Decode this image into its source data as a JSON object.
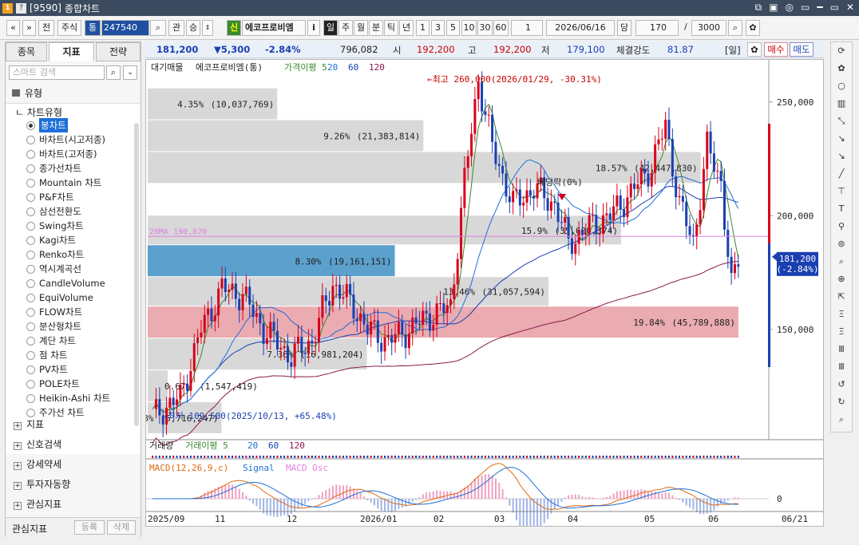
{
  "window": {
    "code": "[9590]",
    "title": "종합차트",
    "controls": [
      "⧉",
      "▣",
      "◎",
      "▭",
      "━",
      "▭",
      "✕"
    ]
  },
  "toolbar": {
    "nav_left": "«",
    "nav_down": "»",
    "jeon": "전",
    "jusik": "주식",
    "tong": "통",
    "code": "247540",
    "kwan": "관",
    "seung": "승",
    "sin_badge": "신",
    "stock_name": "에코프로비엠",
    "info": "i",
    "periods": [
      "일",
      "주",
      "월",
      "분",
      "틱",
      "년"
    ],
    "minute_opts": [
      "1",
      "3",
      "5",
      "10",
      "30",
      "60"
    ],
    "count_sel": "1",
    "date": "2026/06/16",
    "dang": "당",
    "bars": "170",
    "slash": "/",
    "total": "3000"
  },
  "left_panel": {
    "tabs": [
      "종목",
      "지표",
      "전략"
    ],
    "search_placeholder": "스마트 검색",
    "root": "유형",
    "sub_root": "차트유형",
    "chart_types": [
      "봉차트",
      "바차트(시고저종)",
      "바차트(고저종)",
      "종가선차트",
      "Mountain 차트",
      "P&F차트",
      "삼선전환도",
      "Swing차트",
      "Kagi차트",
      "Renko차트",
      "역시계곡선",
      "CandleVolume",
      "EquiVolume",
      "FLOW차트",
      "분산형차트",
      "계단 차트",
      "점 차트",
      "PV차트",
      "POLE차트",
      "Heikin-Ashi 차트",
      "주가선 차트"
    ],
    "groups": [
      "지표",
      "신호검색",
      "강세약세",
      "투자자동향",
      "관심지표"
    ],
    "footer_label": "관심지표",
    "register": "등록",
    "delete": "삭제"
  },
  "quote": {
    "price": "181,200",
    "change": "▼5,300",
    "pct": "-2.84%",
    "volume": "796,082",
    "open_label": "시",
    "open": "192,200",
    "high_label": "고",
    "high": "192,200",
    "low_label": "저",
    "low": "179,100",
    "strength_label": "체결강도",
    "strength": "81.87",
    "period_badge": "[일]",
    "buy": "매수",
    "sell": "매도"
  },
  "legend": {
    "main": [
      "대기매물",
      "에코프로비엠(통)",
      "가격이평 5",
      "20",
      "60",
      "120"
    ],
    "volume": [
      "거래량",
      "거래이평 5",
      "20",
      "60",
      "120"
    ],
    "macd": [
      "MACD(12,26,9,c)",
      "Signal",
      "MACD Osc"
    ]
  },
  "annotations": {
    "high_note": "←최고 260,000(2026/01/29, -30.31%)",
    "low_note": "←최저 109,500(2025/10/13, +65.48%)",
    "dividend": "배당락(0%)",
    "ma20_label": "20MA 190,870",
    "price_tag_1": "181,200",
    "price_tag_2": "(-2.84%)"
  },
  "chart_data": {
    "type": "candlestick",
    "ylim": [
      105000,
      265000
    ],
    "y_ticks": [
      "250,000",
      "200,000",
      "150,000"
    ],
    "x_ticks": [
      "2025/09",
      "11",
      "12",
      "2026/01",
      "02",
      "03",
      "04",
      "05",
      "06",
      "06/21"
    ],
    "volume_profile": [
      {
        "range": [
          242000,
          256000
        ],
        "pct": "4.35%",
        "vol": "(10,037,769)"
      },
      {
        "range": [
          228000,
          242000
        ],
        "pct": "9.26%",
        "vol": "(21,383,814)"
      },
      {
        "range": [
          214000,
          228000
        ],
        "pct": "18.57%",
        "vol": "(42,447,830)"
      },
      {
        "range": [
          200000,
          214000
        ],
        "pct": "",
        "vol": ""
      },
      {
        "range": [
          187000,
          200000
        ],
        "pct": "15.9%",
        "vol": "(35,680,374)"
      },
      {
        "range": [
          173000,
          187000
        ],
        "pct": "8.30%",
        "vol": "(19,161,151)",
        "highlight": "blue"
      },
      {
        "range": [
          160000,
          173000
        ],
        "pct": "13.46%",
        "vol": "(31,057,594)"
      },
      {
        "range": [
          146000,
          160000
        ],
        "pct": "19.84%",
        "vol": "(45,789,888)",
        "highlight": "red"
      },
      {
        "range": [
          132000,
          146000
        ],
        "pct": "7.36%",
        "vol": "(16,981,204)"
      },
      {
        "range": [
          118000,
          132000
        ],
        "pct": "0.67%",
        "vol": "(1,547,419)"
      },
      {
        "range": [
          104000,
          118000
        ],
        "pct": "2.48%",
        "vol": "(5,716,247)"
      }
    ],
    "macd_zero": "0"
  }
}
